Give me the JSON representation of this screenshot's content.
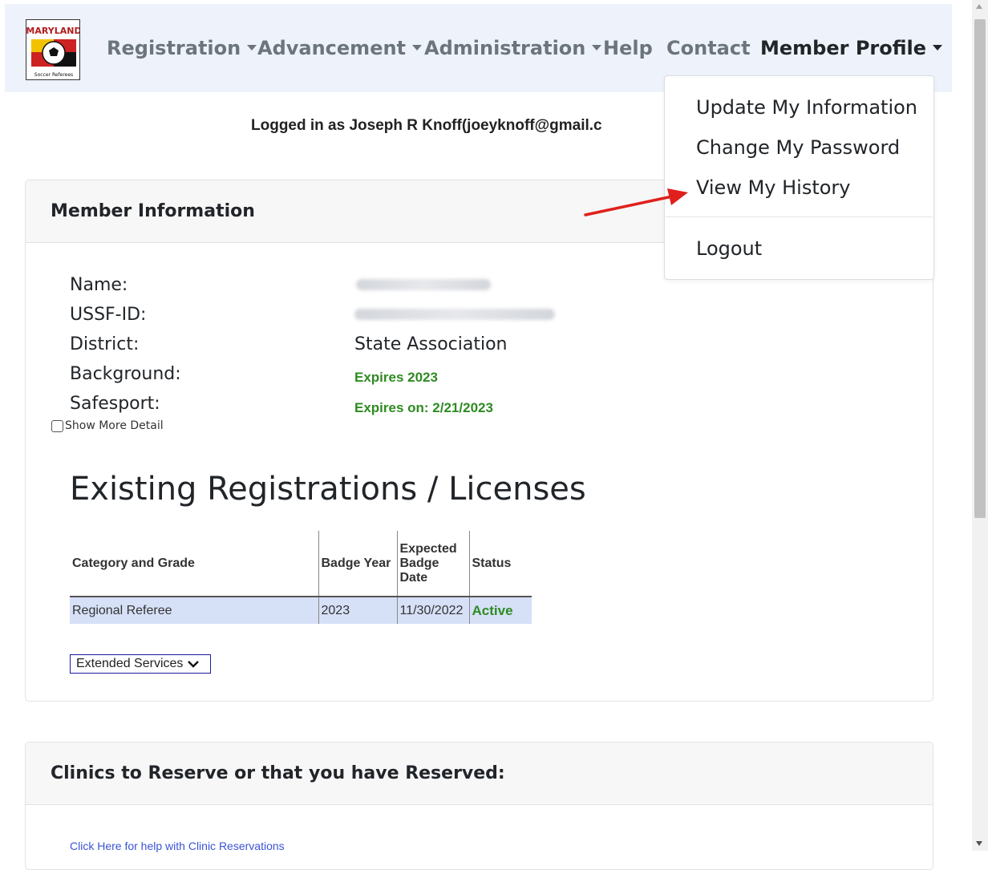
{
  "colors": {
    "accent_green": "#2e8b22",
    "arrow_red": "#e0201c",
    "link_blue": "#3a54d6",
    "row_highlight": "#d6e0f7"
  },
  "nav": {
    "logo_text_top": "MARYLAND",
    "logo_text_bottom": "Soccer Referees",
    "items": [
      {
        "label": "Registration",
        "dropdown": true
      },
      {
        "label": "Advancement",
        "dropdown": true
      },
      {
        "label": "Administration",
        "dropdown": true
      },
      {
        "label": "Help",
        "dropdown": false
      },
      {
        "label": "Contact",
        "dropdown": false
      },
      {
        "label": "Member Profile",
        "dropdown": true
      }
    ]
  },
  "profile_menu": {
    "items": [
      "Update My Information",
      "Change My Password",
      "View My History"
    ],
    "logout": "Logout"
  },
  "logged_in": "Logged in as Joseph R Knoff(joeyknoff@gmail.c",
  "member_card": {
    "title": "Member Information",
    "labels": [
      "Name:",
      "USSF-ID:",
      "District:",
      "Background:",
      "Safesport:"
    ],
    "district": "State Association",
    "background": "Expires 2023",
    "safesport": "Expires on: 2/21/2023",
    "show_more": "Show More Detail",
    "registrations_title": "Existing Registrations / Licenses",
    "table": {
      "headers": [
        "Category and Grade",
        "Badge Year",
        "Expected Badge Date",
        "Status"
      ],
      "rows": [
        {
          "category": "Regional Referee",
          "year": "2023",
          "date": "11/30/2022",
          "status": "Active"
        }
      ]
    },
    "extended_services": "Extended Services"
  },
  "clinics_card": {
    "title": "Clinics to Reserve or that you have Reserved:",
    "help_link": "Click Here for help with Clinic Reservations"
  }
}
